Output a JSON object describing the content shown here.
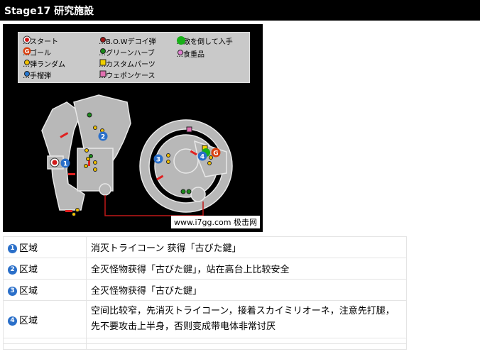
{
  "header": {
    "title": "Stage17 研究施設"
  },
  "map": {
    "legend": {
      "start": "…スタート",
      "goal": "…ゴール",
      "ammo_random": "…弾ランダム",
      "grenade": "…手榴弾",
      "bow_decoy": "…B.O.Wデコイ弾",
      "green_herb": "…グリーンハーブ",
      "custom_parts": "…カスタムパーツ",
      "weapon_case": "…ウェポンケース",
      "defeat_enemy": "…敵を倒して入手",
      "food": "…食重品"
    },
    "start_marker": "S",
    "goal_marker": "G",
    "area_markers": [
      "1",
      "2",
      "3",
      "4"
    ],
    "watermark": "www.i7gg.com 极击网"
  },
  "areas": [
    {
      "num": "1",
      "label": "区域",
      "desc": "消灭トライコーン 获得「古びた鍵」"
    },
    {
      "num": "2",
      "label": "区域",
      "desc": "全灭怪物获得「古びた鍵」，站在高台上比较安全"
    },
    {
      "num": "3",
      "label": "区域",
      "desc": "全灭怪物获得「古びた鍵」"
    },
    {
      "num": "4",
      "label": "区域",
      "desc": "空间比较窄，先消灭トライコーン，接着スカイミリオーネ，注意先打腿，先不要攻击上半身，否则变成带电体非常讨厌"
    }
  ]
}
